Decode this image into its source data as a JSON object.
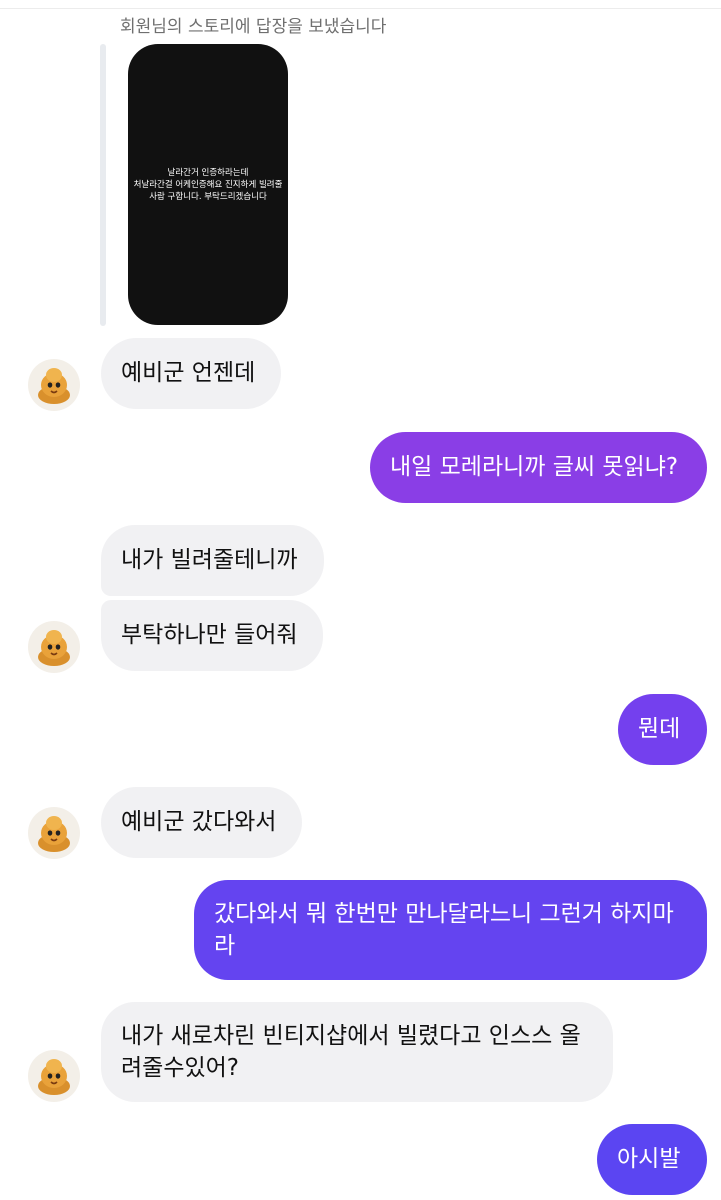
{
  "story": {
    "caption": "회원님의 스토리에 답장을 보냈습니다",
    "text": "날라간거 인증하라는데\n처날라간걸 어케인증해요 진지하게 빌려줄사람 구합니다. 부탁드리겠습니다"
  },
  "messages": [
    {
      "from": "them",
      "text": "예비군 언젠데"
    },
    {
      "from": "me",
      "text": "내일 모레라니까 글씨 못읽냐?"
    },
    {
      "from": "them",
      "text": "내가 빌려줄테니까"
    },
    {
      "from": "them",
      "text": "부탁하나만 들어줘"
    },
    {
      "from": "me",
      "text": "뭔데"
    },
    {
      "from": "them",
      "text": "예비군 갔다와서"
    },
    {
      "from": "me",
      "text": "갔다와서 뭐 한번만 만나달라느니 그런거 하지마라"
    },
    {
      "from": "them",
      "text": "내가 새로차린 빈티지샵에서 빌렸다고 인스스 올려줄수있어?"
    },
    {
      "from": "me",
      "text": "아시발"
    }
  ],
  "colors": {
    "incoming_bubble": "#f1f1f3",
    "outgoing_top": "#8a3ee6",
    "outgoing_mid": "#7440ee",
    "outgoing_bottom": "#5b45f2"
  },
  "icons": {
    "avatar": "cartoon-mascot-avatar"
  }
}
